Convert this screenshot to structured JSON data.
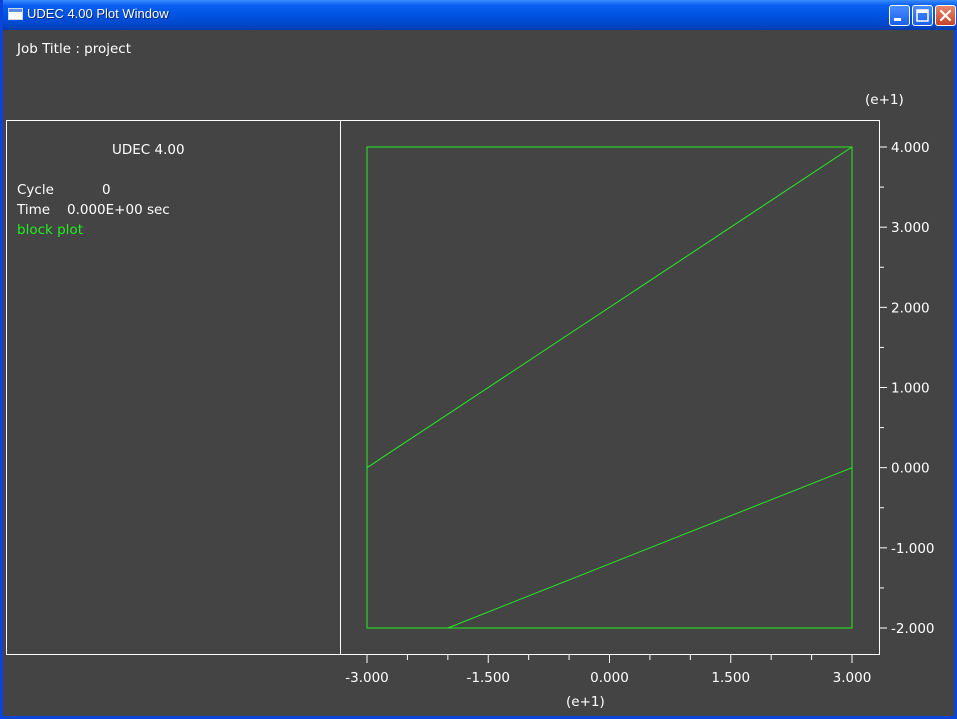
{
  "window": {
    "title": "UDEC 4.00 Plot Window",
    "controls": [
      "minimize",
      "maximize",
      "close"
    ]
  },
  "header": {
    "job_title": "Job Title : project"
  },
  "info_panel": {
    "program": "UDEC 4.00",
    "cycle_label": "Cycle",
    "cycle_value": "0",
    "time_label": "Time",
    "time_value": "0.000E+00 sec",
    "plot_item": "block plot"
  },
  "colors": {
    "background": "#444444",
    "block_lines": "#22ee22",
    "text": "#ffffff",
    "titlebar": "#0054e3"
  },
  "chart_data": {
    "type": "line",
    "xlim": [
      -3.0,
      3.0
    ],
    "ylim": [
      -2.0,
      4.0
    ],
    "x_scale_label": "(e+1)",
    "y_scale_label": "(e+1)",
    "x_ticks": [
      "-3.000",
      "-1.500",
      "0.000",
      "1.500",
      "3.000"
    ],
    "y_ticks": [
      "4.000",
      "3.000",
      "2.000",
      "1.000",
      "0.000",
      "-1.000",
      "-2.000"
    ],
    "boundary": [
      [
        -3.0,
        -2.0
      ],
      [
        3.0,
        -2.0
      ],
      [
        3.0,
        4.0
      ],
      [
        -3.0,
        4.0
      ]
    ],
    "joints": [
      [
        [
          -3.0,
          0.0
        ],
        [
          3.0,
          4.0
        ]
      ],
      [
        [
          -2.0,
          -2.0
        ],
        [
          3.0,
          0.0
        ]
      ]
    ]
  }
}
